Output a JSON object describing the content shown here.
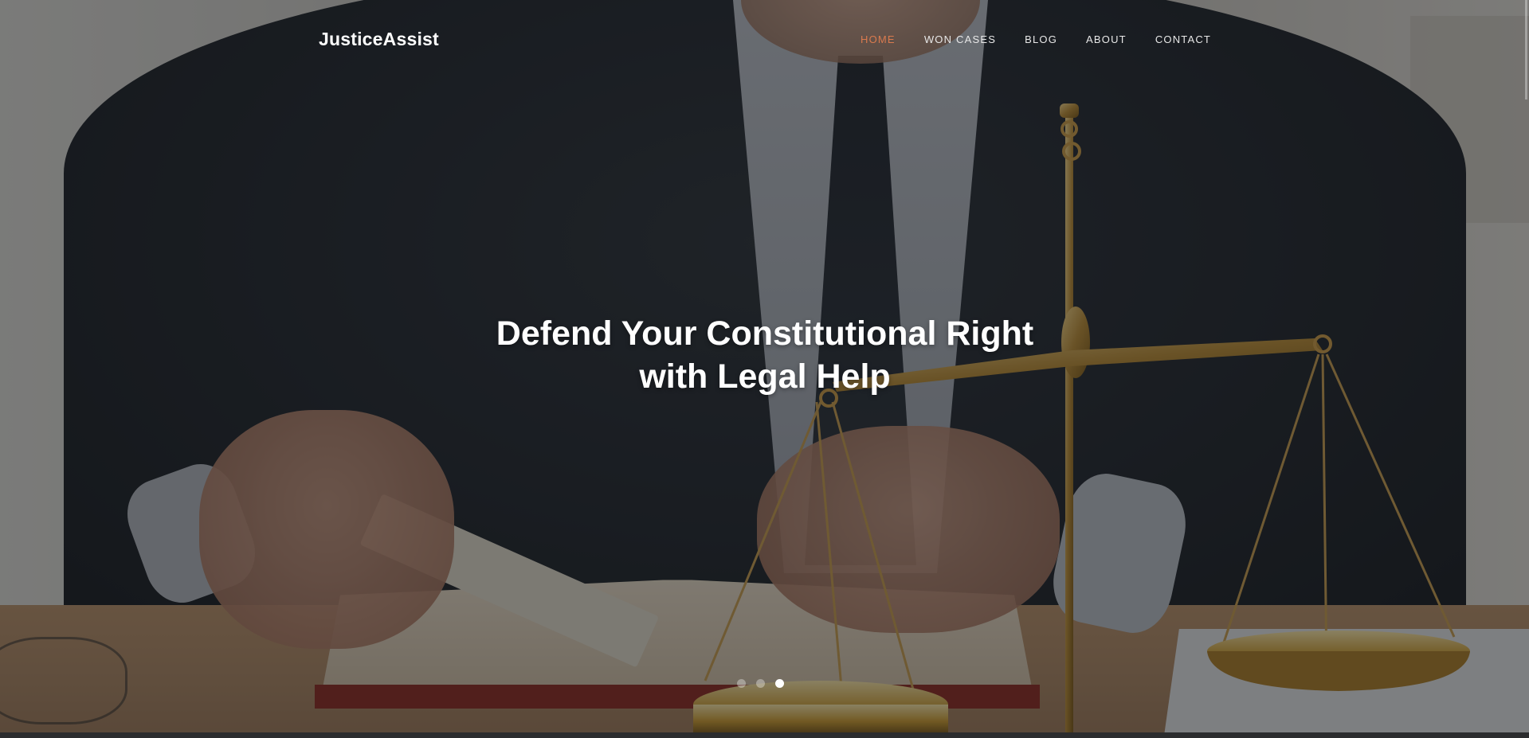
{
  "brand": {
    "name": "JusticeAssist"
  },
  "nav": {
    "items": [
      {
        "label": "HOME",
        "active": true
      },
      {
        "label": "WON CASES",
        "active": false
      },
      {
        "label": "BLOG",
        "active": false
      },
      {
        "label": "ABOUT",
        "active": false
      },
      {
        "label": "CONTACT",
        "active": false
      }
    ]
  },
  "hero": {
    "headline_line1": "Defend Your Constitutional Right",
    "headline_line2": "with Legal Help"
  },
  "carousel": {
    "slide_count": 3,
    "active_slide": 3
  },
  "colors": {
    "accent": "#d97a4e",
    "nav_text": "#e8e8e8",
    "headline_text": "#ffffff"
  },
  "icons": {
    "background_image": "lawyer-with-scales-of-justice-photo"
  }
}
